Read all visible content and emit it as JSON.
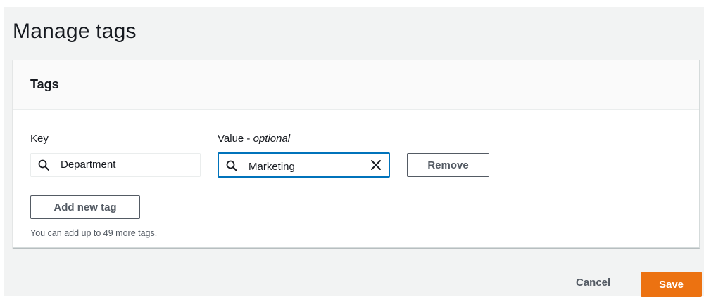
{
  "page": {
    "title": "Manage tags"
  },
  "panel": {
    "title": "Tags",
    "key_label": "Key",
    "value_label_main": "Value - ",
    "value_label_optional": "optional",
    "tags": [
      {
        "key": "Department",
        "value": "Marketing"
      }
    ],
    "remove_label": "Remove",
    "add_tag_label": "Add new tag",
    "hint": "You can add up to 49 more tags."
  },
  "footer": {
    "cancel_label": "Cancel",
    "save_label": "Save"
  },
  "icons": {
    "search": "search-icon",
    "clear": "close-icon"
  },
  "colors": {
    "primary": "#ec7211",
    "focus": "#0073bb",
    "background": "#f2f3f3"
  }
}
